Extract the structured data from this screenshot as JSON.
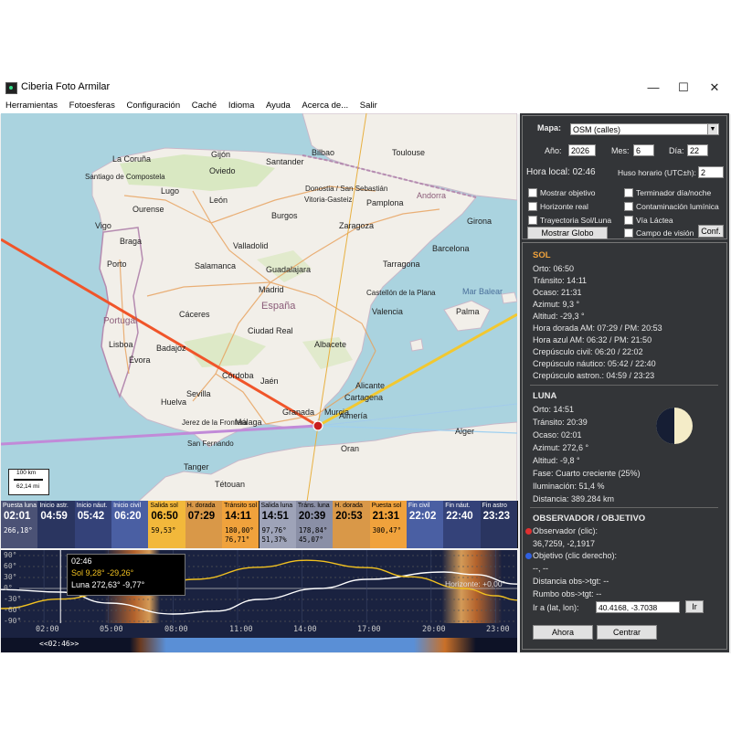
{
  "window": {
    "title": "Ciberia Foto Armilar",
    "minimize": "—",
    "maximize": "☐",
    "close": "✕"
  },
  "menu": [
    "Herramientas",
    "Fotoesferas",
    "Configuración",
    "Caché",
    "Idioma",
    "Ayuda",
    "Acerca de...",
    "Salir"
  ],
  "map": {
    "countries": [
      "Portugal",
      "España",
      "Andorra"
    ],
    "seas": [
      "Mar Balear"
    ],
    "cities": [
      "La Coruña",
      "Santiago de Compostela",
      "Vigo",
      "Ourense",
      "Lugo",
      "Oviedo",
      "Gijón",
      "Santander",
      "Bilbao",
      "Donostia / San Sebastián",
      "Vitoria-Gasteiz",
      "Pamplona",
      "Toulouse",
      "León",
      "Burgos",
      "Braga",
      "Porto",
      "Valladolid",
      "Zaragoza",
      "Salamanca",
      "Guadalajara",
      "Madrid",
      "Girona",
      "Barcelona",
      "Tarragona",
      "Castellón de la Plana",
      "Valencia",
      "Palma",
      "Cáceres",
      "Ciudad Real",
      "Albacete",
      "Alicante",
      "Murcia",
      "Badajoz",
      "Córdoba",
      "Sevilla",
      "Jaén",
      "Granada",
      "Almería",
      "Cartagena",
      "Huelva",
      "Jerez de la Frontera",
      "Málaga",
      "San Fernando",
      "Tanger",
      "Tétouan",
      "Oran",
      "Alger",
      "Lisboa",
      "Évora",
      "Albacete"
    ],
    "scale": {
      "km": "100 km",
      "mi": "62,14 mi"
    }
  },
  "timeline": [
    {
      "label": "Puesta luna",
      "time": "02:01",
      "v1": "266,18°",
      "v2": "",
      "bg": "#4b5275",
      "fg": "#fff"
    },
    {
      "label": "Inicio astr.",
      "time": "04:59",
      "v1": "",
      "v2": "",
      "bg": "#2a3560",
      "fg": "#fff"
    },
    {
      "label": "Inicio náut.",
      "time": "05:42",
      "v1": "",
      "v2": "",
      "bg": "#344279",
      "fg": "#fff"
    },
    {
      "label": "Inicio civil",
      "time": "06:20",
      "v1": "",
      "v2": "",
      "bg": "#4a5fa3",
      "fg": "#fff"
    },
    {
      "label": "Salida sol",
      "time": "06:50",
      "v1": "59,53°",
      "v2": "",
      "bg": "#f2b83b",
      "fg": "#000"
    },
    {
      "label": "H. dorada",
      "time": "07:29",
      "v1": "",
      "v2": "",
      "bg": "#d99848",
      "fg": "#000"
    },
    {
      "label": "Tránsito sol",
      "time": "14:11",
      "v1": "180,00°",
      "v2": "76,71°",
      "bg": "#f0a23c",
      "fg": "#000"
    },
    {
      "label": "Salida luna",
      "time": "14:51",
      "v1": "97,76°",
      "v2": "51,37%",
      "bg": "#9ea3b8",
      "fg": "#000"
    },
    {
      "label": "Tráns. luna",
      "time": "20:39",
      "v1": "178,84°",
      "v2": "45,07°",
      "bg": "#8a8fa6",
      "fg": "#000"
    },
    {
      "label": "H. dorada",
      "time": "20:53",
      "v1": "",
      "v2": "",
      "bg": "#d99848",
      "fg": "#000"
    },
    {
      "label": "Puesta sol",
      "time": "21:31",
      "v1": "300,47°",
      "v2": "",
      "bg": "#f0a23c",
      "fg": "#000"
    },
    {
      "label": "Fin civil",
      "time": "22:02",
      "v1": "",
      "v2": "",
      "bg": "#4a5fa3",
      "fg": "#fff"
    },
    {
      "label": "Fin náut.",
      "time": "22:40",
      "v1": "",
      "v2": "",
      "bg": "#344279",
      "fg": "#fff"
    },
    {
      "label": "Fin astro",
      "time": "23:23",
      "v1": "",
      "v2": "",
      "bg": "#2a3560",
      "fg": "#fff"
    }
  ],
  "graph": {
    "y_ticks": [
      "90°",
      "60°",
      "30°",
      "0°",
      "-30°",
      "-60°",
      "-90°"
    ],
    "x_ticks": [
      "02:00",
      "05:00",
      "08:00",
      "11:00",
      "14:00",
      "17:00",
      "20:00",
      "23:00"
    ],
    "tooltip": {
      "time": "02:46",
      "sun": "Sol  9,28°  -29,26°",
      "moon": "Luna 272,63°  -9,77°"
    },
    "horizon": "Horizonte: +0,00°",
    "nav": "<<02:46>>",
    "sun_color": "#f0c020",
    "moon_color": "#ffffff",
    "time_now_hours": 2.77,
    "sun_altitude_path": [
      [
        0,
        -55
      ],
      [
        2.8,
        -29
      ],
      [
        5,
        -12
      ],
      [
        6.8,
        0
      ],
      [
        9,
        25
      ],
      [
        12,
        58
      ],
      [
        14.2,
        77
      ],
      [
        17,
        57
      ],
      [
        19,
        32
      ],
      [
        21.5,
        0
      ],
      [
        23,
        -20
      ],
      [
        24,
        -32
      ]
    ],
    "moon_altitude_path": [
      [
        0,
        -3
      ],
      [
        2.8,
        -10
      ],
      [
        5,
        -40
      ],
      [
        8,
        -70
      ],
      [
        10,
        -62
      ],
      [
        12,
        -30
      ],
      [
        14.8,
        0
      ],
      [
        17,
        25
      ],
      [
        20.6,
        45
      ],
      [
        22,
        38
      ],
      [
        24,
        12
      ]
    ]
  },
  "panel": {
    "map_label": "Mapa:",
    "map_value": "OSM (calles)",
    "year_label": "Año:",
    "year": "2026",
    "month_label": "Mes:",
    "month": "6",
    "day_label": "Día:",
    "day": "22",
    "local_time": "Hora local: 02:46",
    "tz_label": "Huso horario (UTC±h):",
    "tz": "2",
    "checks_left": [
      "Mostrar objetivo",
      "Horizonte real",
      "Trayectoria Sol/Luna"
    ],
    "checks_right": [
      "Terminador día/noche",
      "Contaminación lumínica",
      "Vía Láctea",
      "Campo de visión"
    ],
    "globe_button": "Mostrar Globo",
    "conf_button": "Conf."
  },
  "sun": {
    "title": "SOL",
    "rows": [
      "Orto: 06:50",
      "Tránsito: 14:11",
      "Ocaso: 21:31",
      "Azimut: 9,3 °",
      "Altitud: -29,3 °",
      "Hora dorada AM: 07:29  /  PM: 20:53",
      "Hora azul AM: 06:32  /  PM: 21:50",
      "Crepúsculo civil: 06:20  /  22:02",
      "Crepúsculo náutico: 05:42  /  22:40",
      "Crepúsculo astron.: 04:59  /  23:23"
    ]
  },
  "moon": {
    "title": "LUNA",
    "rows": [
      "Orto: 14:51",
      "Tránsito: 20:39",
      "Ocaso: 02:01",
      "Azimut: 272,6 °",
      "Altitud: -9,8 °",
      "Fase: Cuarto creciente (25%)",
      "Iluminación: 51,4 %",
      "Distancia: 389.284 km"
    ],
    "illumination": 0.514
  },
  "observer": {
    "title": "OBSERVADOR / OBJETIVO",
    "obs_label": "Observador (clic):",
    "obs_value": "36,7259, -2,1917",
    "tgt_label": "Objetivo (clic derecho):",
    "tgt_value": "--, --",
    "dist": "Distancia obs->tgt: --",
    "bearing": "Rumbo obs->tgt: --",
    "goto_label": "Ir a (lat, lon):",
    "goto_value": "40.4168, -3.7038",
    "go_button": "Ir",
    "now_button": "Ahora",
    "center_button": "Centrar",
    "obs_color": "#e03030",
    "tgt_color": "#3060e0"
  }
}
